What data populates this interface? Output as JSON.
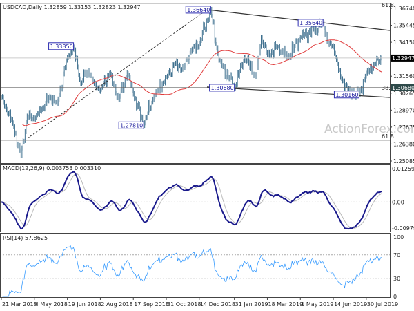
{
  "chart_data": {
    "type": "ohlc",
    "symbol_header": "USDCAD,Daily  1.32859 1.33153 1.32823 1.32947",
    "watermark": "ActionForex.com",
    "price_axis": {
      "range": [
        1.25085,
        1.3674
      ],
      "ticks": [
        "1.36740",
        "1.35445",
        "1.34150",
        "1.31560",
        "1.30265",
        "1.28970",
        "1.27675",
        "1.26380",
        "1.25085"
      ],
      "current_price": "1.32947",
      "marked_level": "1.30680"
    },
    "colors": {
      "bars": "#3d6f8e",
      "moving_average": "#e03c3c",
      "macd": "#1a1a8c",
      "macd_signal": "#b8b8b8",
      "rsi": "#3399ff",
      "label_border": "#2b2bb0",
      "current_price_box": "#000000",
      "level_box": "#2e4a4a"
    },
    "price_keypoints": [
      [
        "2018-03-21",
        1.3
      ],
      [
        "2018-03-28",
        1.29
      ],
      [
        "2018-04-05",
        1.28
      ],
      [
        "2018-04-17",
        1.255
      ],
      [
        "2018-04-25",
        1.285
      ],
      [
        "2018-05-04",
        1.283
      ],
      [
        "2018-05-15",
        1.29
      ],
      [
        "2018-05-25",
        1.3
      ],
      [
        "2018-06-05",
        1.295
      ],
      [
        "2018-06-19",
        1.33
      ],
      [
        "2018-06-27",
        1.3385
      ],
      [
        "2018-07-06",
        1.31
      ],
      [
        "2018-07-17",
        1.32
      ],
      [
        "2018-07-25",
        1.31
      ],
      [
        "2018-08-02",
        1.305
      ],
      [
        "2018-08-15",
        1.318
      ],
      [
        "2018-08-28",
        1.298
      ],
      [
        "2018-09-07",
        1.318
      ],
      [
        "2018-09-17",
        1.302
      ],
      [
        "2018-10-01",
        1.2781
      ],
      [
        "2018-10-15",
        1.3
      ],
      [
        "2018-10-31",
        1.315
      ],
      [
        "2018-11-12",
        1.325
      ],
      [
        "2018-11-23",
        1.322
      ],
      [
        "2018-12-04",
        1.335
      ],
      [
        "2018-12-14",
        1.34
      ],
      [
        "2018-12-31",
        1.3664
      ],
      [
        "2019-01-10",
        1.328
      ],
      [
        "2019-01-31",
        1.3068
      ],
      [
        "2019-02-14",
        1.33
      ],
      [
        "2019-03-01",
        1.315
      ],
      [
        "2019-03-08",
        1.345
      ],
      [
        "2019-03-18",
        1.332
      ],
      [
        "2019-04-01",
        1.338
      ],
      [
        "2019-04-15",
        1.33
      ],
      [
        "2019-05-01",
        1.345
      ],
      [
        "2019-05-31",
        1.3564
      ],
      [
        "2019-06-07",
        1.34
      ],
      [
        "2019-06-14",
        1.338
      ],
      [
        "2019-06-25",
        1.315
      ],
      [
        "2019-07-05",
        1.305
      ],
      [
        "2019-07-19",
        1.3016
      ],
      [
        "2019-07-30",
        1.318
      ],
      [
        "2019-08-09",
        1.325
      ],
      [
        "2019-08-20",
        1.3295
      ]
    ],
    "price_labels": [
      {
        "text": "1.36640",
        "date": "2018-12-31",
        "price": 1.3664,
        "pos": "left"
      },
      {
        "text": "1.33850",
        "date": "2018-06-27",
        "price": 1.3385,
        "pos": "left"
      },
      {
        "text": "1.27810",
        "date": "2018-10-01",
        "price": 1.2781,
        "pos": "left"
      },
      {
        "text": "1.30680",
        "date": "2019-01-31",
        "price": 1.3068,
        "pos": "left"
      },
      {
        "text": "1.35640",
        "date": "2019-05-31",
        "price": 1.3564,
        "pos": "left"
      },
      {
        "text": "1.30160",
        "date": "2019-07-19",
        "price": 1.3016,
        "pos": "left"
      }
    ],
    "fib_labels": {
      "top": "61.8",
      "mid": "38.2",
      "bottom": "61.8"
    },
    "macd": {
      "title": "MACD(12,26,9) 0.003753 0.003310",
      "ticks": [
        "0.012599",
        "0.00",
        "-0.00979"
      ],
      "range": [
        -0.00979,
        0.012599
      ]
    },
    "rsi": {
      "title": "RSI(14) 57.8625",
      "ticks": [
        "100",
        "70",
        "30",
        "0"
      ],
      "levels": [
        70,
        30
      ]
    },
    "x_ticks": [
      "21 Mar 2018",
      "4 May 2018",
      "19 Jun 2018",
      "2 Aug 2018",
      "17 Sep 2018",
      "31 Oct 2018",
      "14 Dec 2018",
      "31 Jan 2019",
      "18 Mar 2019",
      "1 May 2019",
      "14 Jun 2019",
      "30 Jul 2019"
    ],
    "x_tick_dates": [
      "2018-03-21",
      "2018-05-04",
      "2018-06-19",
      "2018-08-02",
      "2018-09-17",
      "2018-10-31",
      "2018-12-14",
      "2019-01-31",
      "2019-03-18",
      "2019-05-01",
      "2019-06-14",
      "2019-07-30"
    ]
  }
}
